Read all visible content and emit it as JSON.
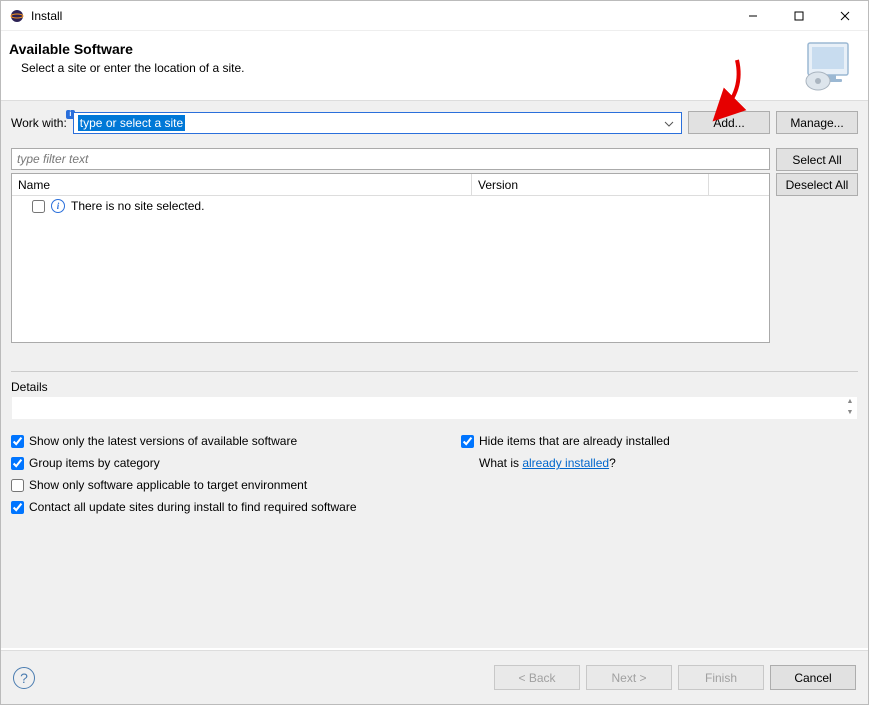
{
  "window": {
    "title": "Install"
  },
  "banner": {
    "heading": "Available Software",
    "subtitle": "Select a site or enter the location of a site."
  },
  "workwith": {
    "label": "Work with:",
    "selected_text": "type or select a site",
    "add_label": "Add...",
    "manage_label": "Manage..."
  },
  "filter": {
    "placeholder": "type filter text",
    "select_all_label": "Select All",
    "deselect_all_label": "Deselect All"
  },
  "tree": {
    "col_name": "Name",
    "col_version": "Version",
    "empty_message": "There is no site selected."
  },
  "details": {
    "label": "Details"
  },
  "options": {
    "show_latest": "Show only the latest versions of available software",
    "group_by_category": "Group items by category",
    "show_applicable": "Show only software applicable to target environment",
    "contact_all_sites": "Contact all update sites during install to find required software",
    "hide_installed": "Hide items that are already installed",
    "whatis_prefix": "What is ",
    "already_link": "already installed",
    "whatis_suffix": "?"
  },
  "footer": {
    "back": "< Back",
    "next": "Next >",
    "finish": "Finish",
    "cancel": "Cancel"
  }
}
